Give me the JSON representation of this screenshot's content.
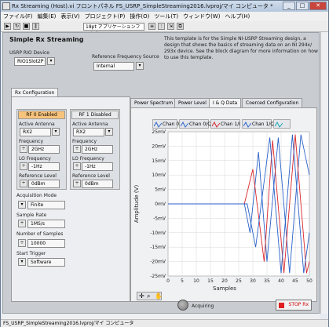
{
  "window": {
    "title": "Rx Streaming (Host).vi フロントパネル  FS_USRP_SimpleStreaming2016.lvproj/マイ コンピュータ *",
    "status_path": "FS_USRP_SimpleStreaming2016.lvproj/マイ コンピュータ"
  },
  "menu": [
    "ファイル(F)",
    "編集(E)",
    "表示(V)",
    "プロジェクト(P)",
    "操作(O)",
    "ツール(T)",
    "ウィンドウ(W)",
    "ヘルプ(H)"
  ],
  "toolbar": {
    "font_label": "18pt アプリケーションフォント"
  },
  "panel": {
    "title": "Simple Rx Streaming",
    "description": "This template is for the Simple NI-USRP Streaming design, a design that shows the basics of streaming data on an NI 294x/ 293x device. See the block diagram for more information on how to use this template.",
    "rio_label": "USRP RIO Device",
    "rio_value": "RIO1Slot2P",
    "ref_label": "Reference Frequency Source",
    "ref_value": "Internal"
  },
  "config": {
    "tab": "Rx Configuration",
    "rf0": {
      "button": "RF 0 Enabled",
      "antenna_label": "Active Antenna",
      "antenna": "RX2",
      "freq_label": "Frequency",
      "freq": "2GHz",
      "lo_label": "LO Frequency",
      "lo": "-1Hz",
      "ref_level_label": "Reference Level",
      "ref_level": "0dBm"
    },
    "rf1": {
      "button": "RF 1 Disabled",
      "antenna_label": "Active Antenna",
      "antenna": "RX2",
      "freq_label": "Frequency",
      "freq": "2GHz",
      "lo_label": "LO Frequency",
      "lo": "-1Hz",
      "ref_level_label": "Reference Level",
      "ref_level": "0dBm"
    },
    "acq_mode_label": "Acquisition Mode",
    "acq_mode": "Finite",
    "sample_rate_label": "Sample Rate",
    "sample_rate": "1MS/s",
    "num_samples_label": "Number of Samples",
    "num_samples": "10000",
    "start_trigger_label": "Start Trigger",
    "start_trigger": "Software"
  },
  "plot_tabs": [
    "Power Spectrum",
    "Power Level",
    "I & Q Data",
    "Coerced Configuration"
  ],
  "legend": [
    {
      "name": "Chan 0/I",
      "color": "#2a62c8"
    },
    {
      "name": "Chan 0/Q",
      "color": "#2a62c8"
    },
    {
      "name": "Chan 1/I",
      "color": "#d9262a"
    },
    {
      "name": "Chan 1/Q",
      "color": "#2a62c8"
    },
    {
      "name": "Chan",
      "color": "#14a8b4"
    }
  ],
  "status": {
    "acquiring": "Acquiring",
    "stop": "STOP Rx"
  },
  "chart_data": {
    "type": "line",
    "xlabel": "Samples",
    "ylabel": "Amplitude (V)",
    "xlim": [
      0,
      50
    ],
    "ylim": [
      -0.025,
      0.025
    ],
    "xticks": [
      "0",
      "5",
      "10",
      "15",
      "20",
      "25",
      "30",
      "35",
      "40",
      "45",
      "50"
    ],
    "yticks": [
      "25mV",
      "20mV",
      "15mV",
      "10mV",
      "5mV",
      "0mV",
      "-5mV",
      "-10mV",
      "-15mV",
      "-20mV",
      "-25mV"
    ],
    "series": [
      {
        "name": "Chan 0/I",
        "color": "#2a62c8",
        "points": [
          [
            0,
            0
          ],
          [
            27,
            0
          ],
          [
            29,
            -0.01
          ],
          [
            32,
            0.018
          ],
          [
            35,
            -0.02
          ],
          [
            39,
            0.023
          ],
          [
            43,
            -0.024
          ],
          [
            47,
            0.024
          ],
          [
            50,
            0.01
          ]
        ]
      },
      {
        "name": "Chan 1/I",
        "color": "#d9262a",
        "points": [
          [
            0,
            0
          ],
          [
            27,
            0
          ],
          [
            30,
            0.012
          ],
          [
            34,
            -0.02
          ],
          [
            37,
            0.022
          ],
          [
            41,
            -0.024
          ],
          [
            45,
            0.024
          ],
          [
            49,
            -0.024
          ],
          [
            50,
            -0.02
          ]
        ]
      },
      {
        "name": "Chan 0/Q",
        "color": "#2a62c8",
        "points": [
          [
            0,
            0
          ],
          [
            28,
            0
          ],
          [
            31,
            -0.015
          ],
          [
            36,
            0.023
          ],
          [
            40,
            -0.024
          ],
          [
            44,
            0.024
          ],
          [
            48,
            -0.024
          ],
          [
            50,
            -0.01
          ]
        ]
      }
    ]
  }
}
